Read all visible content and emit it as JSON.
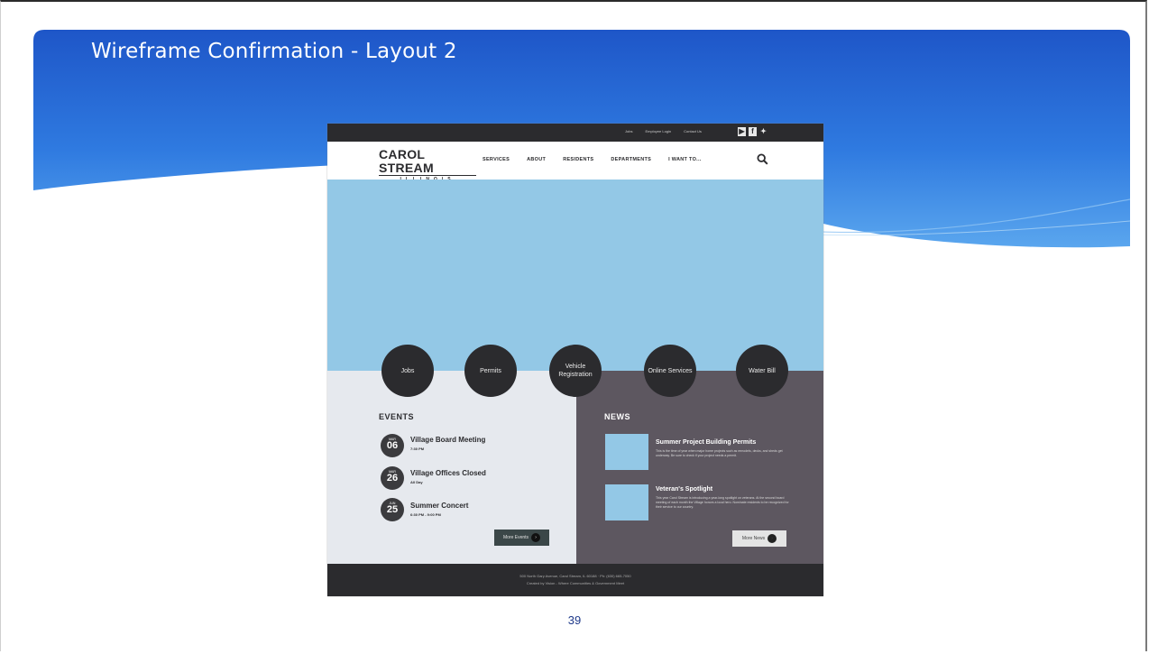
{
  "slide": {
    "title": "Wireframe Confirmation - Layout 2",
    "page_number": "39",
    "colors": {
      "banner_dark": "#1e56c8",
      "banner_light": "#5aa6ee",
      "title_text": "#ffffff"
    }
  },
  "site": {
    "utility_links": [
      "Jobs",
      "Employee Login",
      "Contact Us"
    ],
    "social_icons": [
      "youtube-icon",
      "facebook-icon",
      "twitter-icon"
    ],
    "logo": {
      "main": "CAROL STREAM",
      "sub": "ILLINOIS"
    },
    "nav": [
      "SERVICES",
      "ABOUT",
      "RESIDENTS",
      "DEPARTMENTS",
      "I WANT TO..."
    ],
    "quick_links": [
      "Jobs",
      "Permits",
      "Vehicle Registration",
      "Online Services",
      "Water Bill"
    ],
    "events": {
      "title": "EVENTS",
      "items": [
        {
          "month": "MAR",
          "day": "06",
          "name": "Village Board Meeting",
          "time": "7:30 PM"
        },
        {
          "month": "MAR",
          "day": "26",
          "name": "Village Offices Closed",
          "time": "All Day"
        },
        {
          "month": "JUN",
          "day": "25",
          "name": "Summer Concert",
          "time": "6:30 PM - 9:00 PM"
        }
      ],
      "more_label": "More Events"
    },
    "news": {
      "title": "NEWS",
      "items": [
        {
          "headline": "Summer Project Building Permits",
          "text": "This is the time of year when major home projects such as remodels, decks, and sheds get underway. Be sure to check if your project needs a permit."
        },
        {
          "headline": "Veteran's Spotlight",
          "text": "This year Carol Stream is introducing a year-long spotlight on veterans. At the second board meeting of each month the Village honors a local hero. Nominate residents to be recognized for their service to our country."
        }
      ],
      "more_label": "More News"
    },
    "footer": {
      "line1": "500 North Gary Avenue, Carol Stream, IL 60188  ·  Ph: (630) 665-7050",
      "line2": "Created by Vision - Where Communities & Government Meet"
    },
    "colors": {
      "dark": "#2b2b2e",
      "hero": "#93c8e6",
      "events_bg": "#e6e9ee",
      "news_bg": "#5d5760"
    }
  }
}
